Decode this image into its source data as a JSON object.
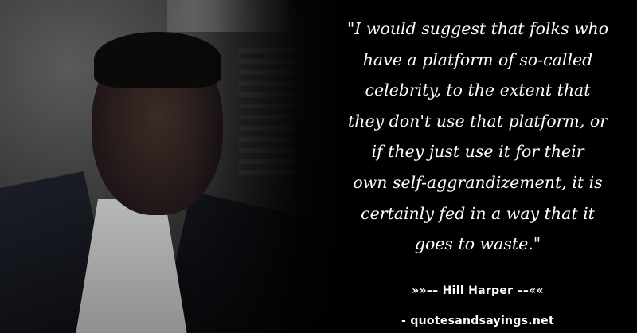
{
  "quote": {
    "lines": [
      "\"I would suggest that folks who",
      "have a platform of so-called",
      "celebrity, to the extent that",
      "they don't use that platform, or",
      "if they just use it for their",
      "own self-aggrandizement, it is",
      "certainly fed in a way that it",
      "goes to waste.\""
    ]
  },
  "attribution": "»»–– Hill Harper ––««",
  "source": "- quotesandsayings.net",
  "colors": {
    "background": "#000000",
    "text": "#ffffff"
  }
}
